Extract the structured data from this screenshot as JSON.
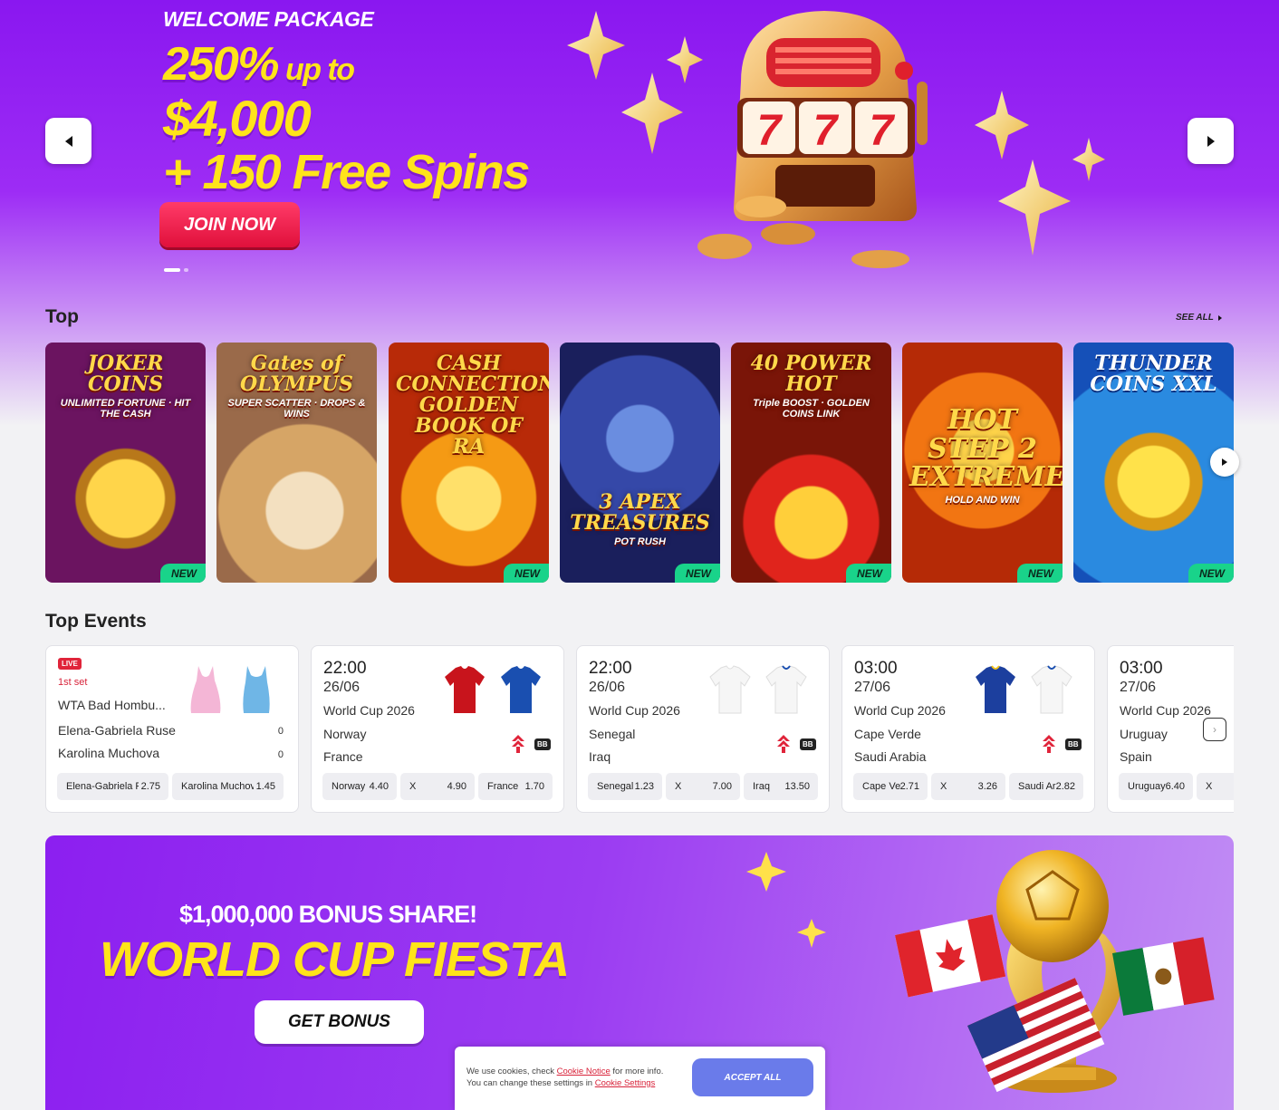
{
  "hero": {
    "kicker": "WELCOME PACKAGE",
    "line1_big": "250%",
    "line1_small": " up to",
    "line2": "$4,000",
    "line3": "+ 150 Free Spins",
    "cta": "JOIN NOW",
    "slides": 2,
    "active_slide": 1,
    "colors": {
      "accent": "#ffe41a",
      "cta": "#ff2c57",
      "bg": "#8a17f0"
    }
  },
  "top_section": {
    "title": "Top",
    "see_all": "SEE ALL",
    "games": [
      {
        "title": "JOKER COINS",
        "subtitle": "UNLIMITED FORTUNE · HIT THE CASH",
        "badge": "NEW",
        "color": "#8b1f6b"
      },
      {
        "title": "Gates of OLYMPUS",
        "subtitle": "SUPER SCATTER · DROPS & WINS",
        "badge": "",
        "color": "#c9986a"
      },
      {
        "title": "CASH CONNECTION GOLDEN BOOK OF RA",
        "subtitle": "",
        "badge": "NEW",
        "color": "#c2380b"
      },
      {
        "title": "3 APEX TREASURES",
        "subtitle": "POT RUSH",
        "badge": "NEW",
        "color": "#2a3a8c"
      },
      {
        "title": "40 POWER HOT",
        "subtitle": "Triple BOOST · GOLDEN COINS LINK",
        "badge": "NEW",
        "color": "#a1200d"
      },
      {
        "title": "HOT STEP 2 EXTREME",
        "subtitle": "HOLD AND WIN",
        "badge": "NEW",
        "color": "#e24a0a"
      },
      {
        "title": "THUNDER COINS XXL",
        "subtitle": "",
        "badge": "NEW",
        "color": "#1f77d8"
      }
    ]
  },
  "events_section": {
    "title": "Top Events",
    "events": [
      {
        "live": "LIVE",
        "set": "1st set",
        "league": "WTA Bad Hombu...",
        "team1": "Elena-Gabriela Ruse",
        "team2": "Karolina Muchova",
        "score1": "0",
        "score2": "0",
        "shirt1": "#f4b6d6",
        "shirt2": "#6fb6e6",
        "odds": [
          {
            "label": "Elena-Gabriela Ruse",
            "value": "2.75"
          },
          {
            "label": "Karolina Muchova",
            "value": "1.45"
          }
        ]
      },
      {
        "time": "22:00",
        "date": "26/06",
        "league": "World Cup 2026",
        "team1": "Norway",
        "team2": "France",
        "shirt1": "#c8141c",
        "shirt2": "#1a4fb0",
        "badge": "BB",
        "odds": [
          {
            "label": "Norway",
            "value": "4.40"
          },
          {
            "label": "X",
            "value": "4.90"
          },
          {
            "label": "France",
            "value": "1.70"
          }
        ]
      },
      {
        "time": "22:00",
        "date": "26/06",
        "league": "World Cup 2026",
        "team1": "Senegal",
        "team2": "Iraq",
        "shirt1": "#f4f4f4",
        "shirt2": "#f4f4f4",
        "badge": "BB",
        "odds": [
          {
            "label": "Senegal",
            "value": "1.23"
          },
          {
            "label": "X",
            "value": "7.00"
          },
          {
            "label": "Iraq",
            "value": "13.50"
          }
        ]
      },
      {
        "time": "03:00",
        "date": "27/06",
        "league": "World Cup 2026",
        "team1": "Cape Verde",
        "team2": "Saudi Arabia",
        "shirt1": "#1c3f9e",
        "shirt2": "#f4f4f4",
        "badge": "BB",
        "odds": [
          {
            "label": "Cape Verde",
            "value": "2.71"
          },
          {
            "label": "X",
            "value": "3.26"
          },
          {
            "label": "Saudi Arabia",
            "value": "2.82"
          }
        ]
      },
      {
        "time": "03:00",
        "date": "27/06",
        "league": "World Cup 2026",
        "team1": "Uruguay",
        "team2": "Spain",
        "odds": [
          {
            "label": "Uruguay",
            "value": "6.40"
          },
          {
            "label": "X",
            "value": ""
          }
        ]
      }
    ]
  },
  "promo": {
    "kicker": "$1,000,000 BONUS SHARE!",
    "title": "WORLD CUP FIESTA",
    "cta": "GET BONUS"
  },
  "cookie": {
    "text_a": "We use cookies, check ",
    "link1": "Cookie Notice",
    "text_b": " for more info.",
    "text_c": "You can change these settings in ",
    "link2": "Cookie Settings",
    "button": "ACCEPT ALL"
  }
}
